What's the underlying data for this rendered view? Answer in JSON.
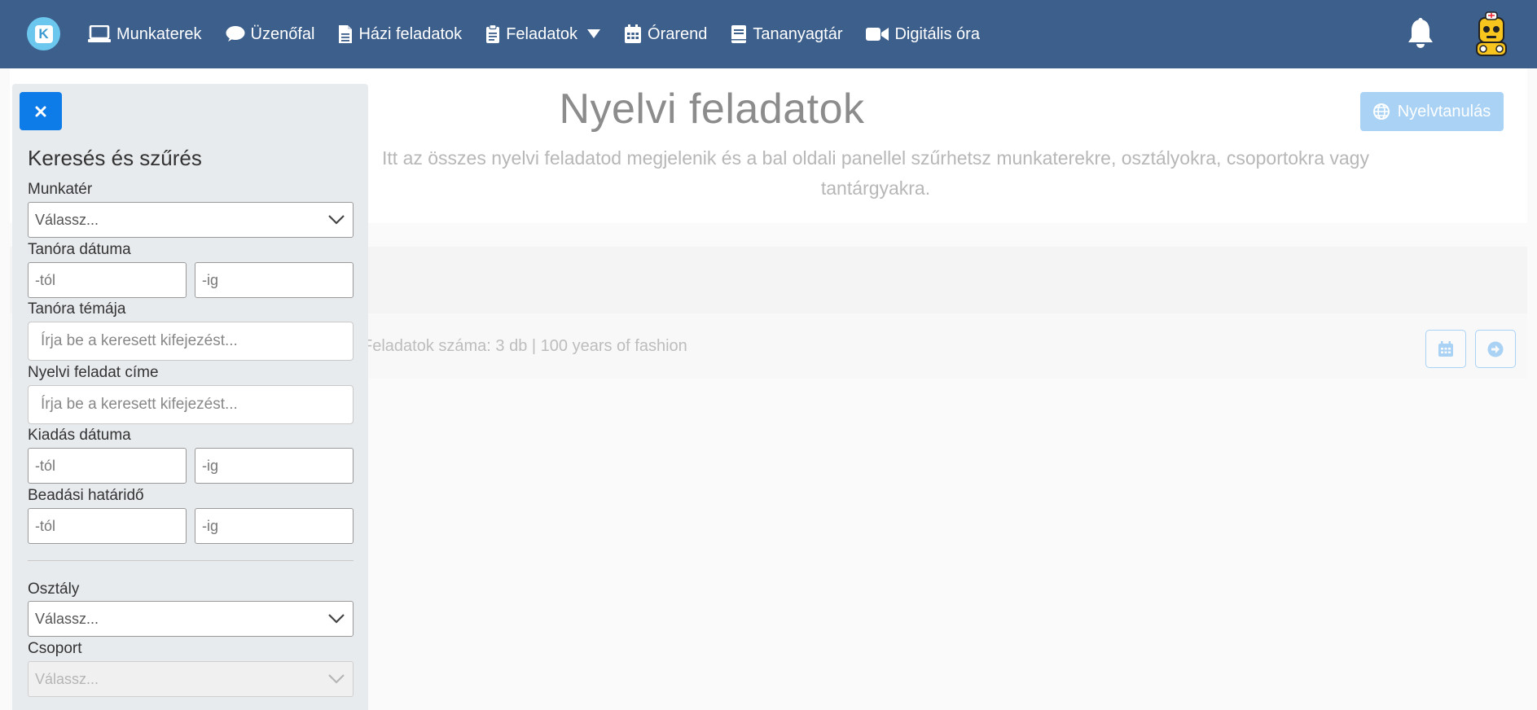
{
  "nav": {
    "logo_letter": "K",
    "items": [
      {
        "label": "Munkaterek",
        "icon": "laptop-icon"
      },
      {
        "label": "Üzenőfal",
        "icon": "comment-icon"
      },
      {
        "label": "Házi feladatok",
        "icon": "file-icon"
      },
      {
        "label": "Feladatok",
        "icon": "clipboard-icon",
        "dropdown": true
      },
      {
        "label": "Órarend",
        "icon": "calendar-icon"
      },
      {
        "label": "Tananyagtár",
        "icon": "book-icon"
      },
      {
        "label": "Digitális óra",
        "icon": "video-icon"
      }
    ],
    "notifications_icon": "bell-icon",
    "avatar_icon": "robot-avatar"
  },
  "main": {
    "title": "Nyelvi feladatok",
    "description": "Itt az összes nyelvi feladatod megjelenik és a bal oldali panellel szűrhetsz munkaterekre, osztályokra, csoportokra vagy tantárgyakra.",
    "language_button": "Nyelvtanulás",
    "results_text": "Feladatok száma: 3 db | 100 years of fashion"
  },
  "panel": {
    "close_label": "×",
    "title": "Keresés és szűrés",
    "workspace_label": "Munkatér",
    "workspace_value": "Válassz...",
    "lesson_date_label": "Tanóra dátuma",
    "from_placeholder": "-tól",
    "to_placeholder": "-ig",
    "lesson_topic_label": "Tanóra témája",
    "search_placeholder": "Írja be a keresett kifejezést...",
    "task_title_label": "Nyelvi feladat címe",
    "issue_date_label": "Kiadás dátuma",
    "deadline_label": "Beadási határidő",
    "class_label": "Osztály",
    "class_value": "Válassz...",
    "group_label": "Csoport",
    "group_value": "Válassz..."
  },
  "colors": {
    "nav_bg": "#3d5f8c",
    "primary": "#0d7be8",
    "accent_light": "#a9d2f5",
    "panel_bg": "#e8ebee"
  }
}
